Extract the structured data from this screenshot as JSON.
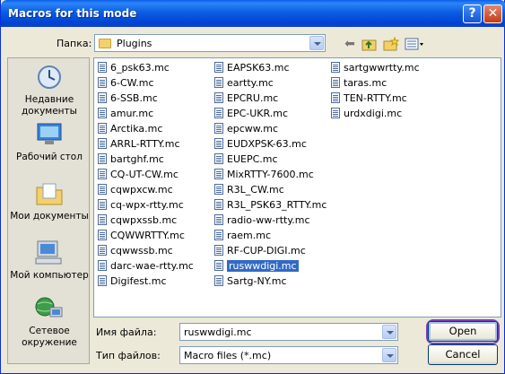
{
  "window": {
    "title": "Macros for this mode",
    "help_btn": "?",
    "close_btn": "✕"
  },
  "lookin": {
    "label": "Папка:",
    "folder": "Plugins"
  },
  "places": [
    {
      "label": "Недавние документы",
      "icon": "recent-documents-icon"
    },
    {
      "label": "Рабочий стол",
      "icon": "desktop-icon"
    },
    {
      "label": "Мои документы",
      "icon": "my-documents-icon"
    },
    {
      "label": "Мой компьютер",
      "icon": "my-computer-icon"
    },
    {
      "label": "Сетевое окружение",
      "icon": "network-places-icon"
    }
  ],
  "files": {
    "col1": [
      "6_psk63.mc",
      "6-CW.mc",
      "6-SSB.mc",
      "amur.mc",
      "Arctika.mc",
      "ARRL-RTTY.mc",
      "bartghf.mc",
      "CQ-UT-CW.mc",
      "cqwpxcw.mc",
      "cq-wpx-rtty.mc",
      "cqwpxssb.mc",
      "CQWWRTTY.mc",
      "cqwwssb.mc",
      "darc-wae-rtty.mc",
      "Digifest.mc"
    ],
    "col2": [
      "EAPSK63.mc",
      "eartty.mc",
      "EPCRU.mc",
      "EPC-UKR.mc",
      "epcww.mc",
      "EUDXPSK-63.mc",
      "EUEPC.mc",
      "MixRTTY-7600.mc",
      "R3L_CW.mc",
      "R3L_PSK63_RTTY.mc",
      "radio-ww-rtty.mc",
      "raem.mc",
      "RF-CUP-DIGI.mc",
      "ruswwdigi.mc",
      "Sartg-NY.mc"
    ],
    "col3": [
      "sartgwwrtty.mc",
      "taras.mc",
      "TEN-RTTY.mc",
      "urdxdigi.mc"
    ],
    "selected": "ruswwdigi.mc"
  },
  "filename": {
    "label": "Имя файла:",
    "value": "ruswwdigi.mc"
  },
  "filetype": {
    "label": "Тип файлов:",
    "value": "Macro files (*.mc)"
  },
  "buttons": {
    "open": "Open",
    "cancel": "Cancel"
  },
  "colors": {
    "titlebar": "#0a5ee9",
    "selection": "#316ac5",
    "focus_ring": "#7a3fb0"
  }
}
